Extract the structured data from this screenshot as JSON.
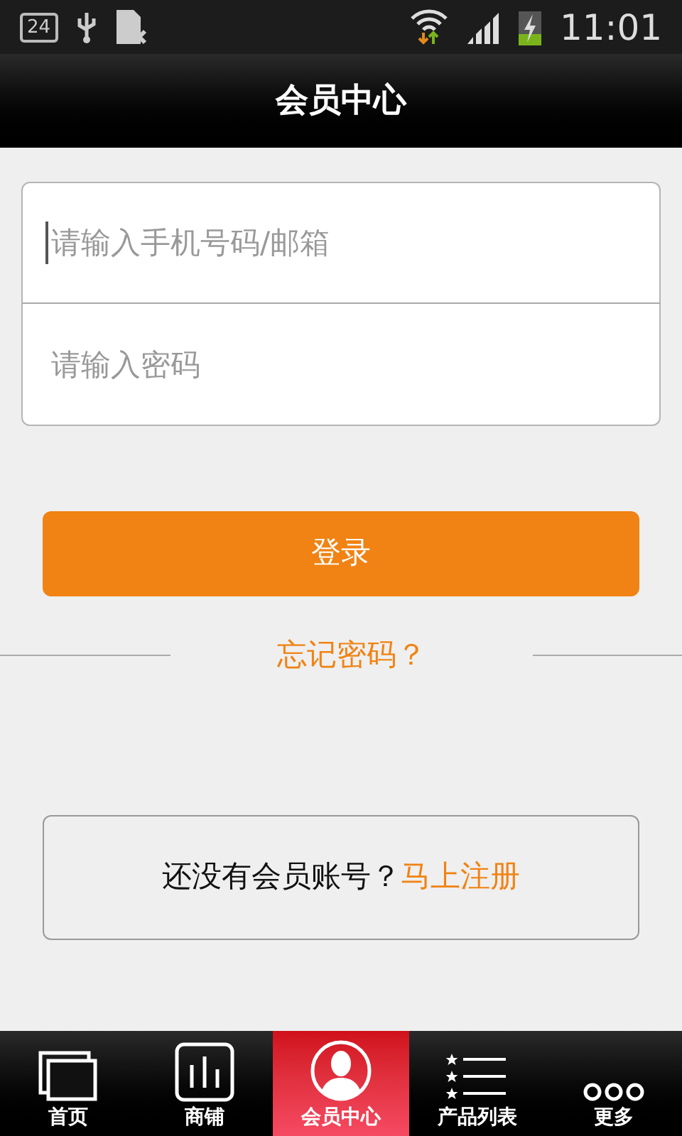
{
  "status_bar": {
    "badge": "24",
    "time": "11:01"
  },
  "header": {
    "title": "会员中心"
  },
  "form": {
    "fields": [
      {
        "placeholder": "请输入手机号码/邮箱",
        "focused": true
      },
      {
        "placeholder": "请输入密码",
        "focused": false
      }
    ]
  },
  "login_button": "登录",
  "forgot_link": "忘记密码？",
  "register": {
    "prompt": "还没有会员账号？",
    "link": "马上注册"
  },
  "tabs": [
    {
      "kind": "home",
      "label": "首页",
      "selected": false
    },
    {
      "kind": "shop",
      "label": "商铺",
      "selected": false
    },
    {
      "kind": "member",
      "label": "会员中心",
      "selected": true
    },
    {
      "kind": "list",
      "label": "产品列表",
      "selected": false
    },
    {
      "kind": "more",
      "label": "更多",
      "selected": false
    }
  ]
}
